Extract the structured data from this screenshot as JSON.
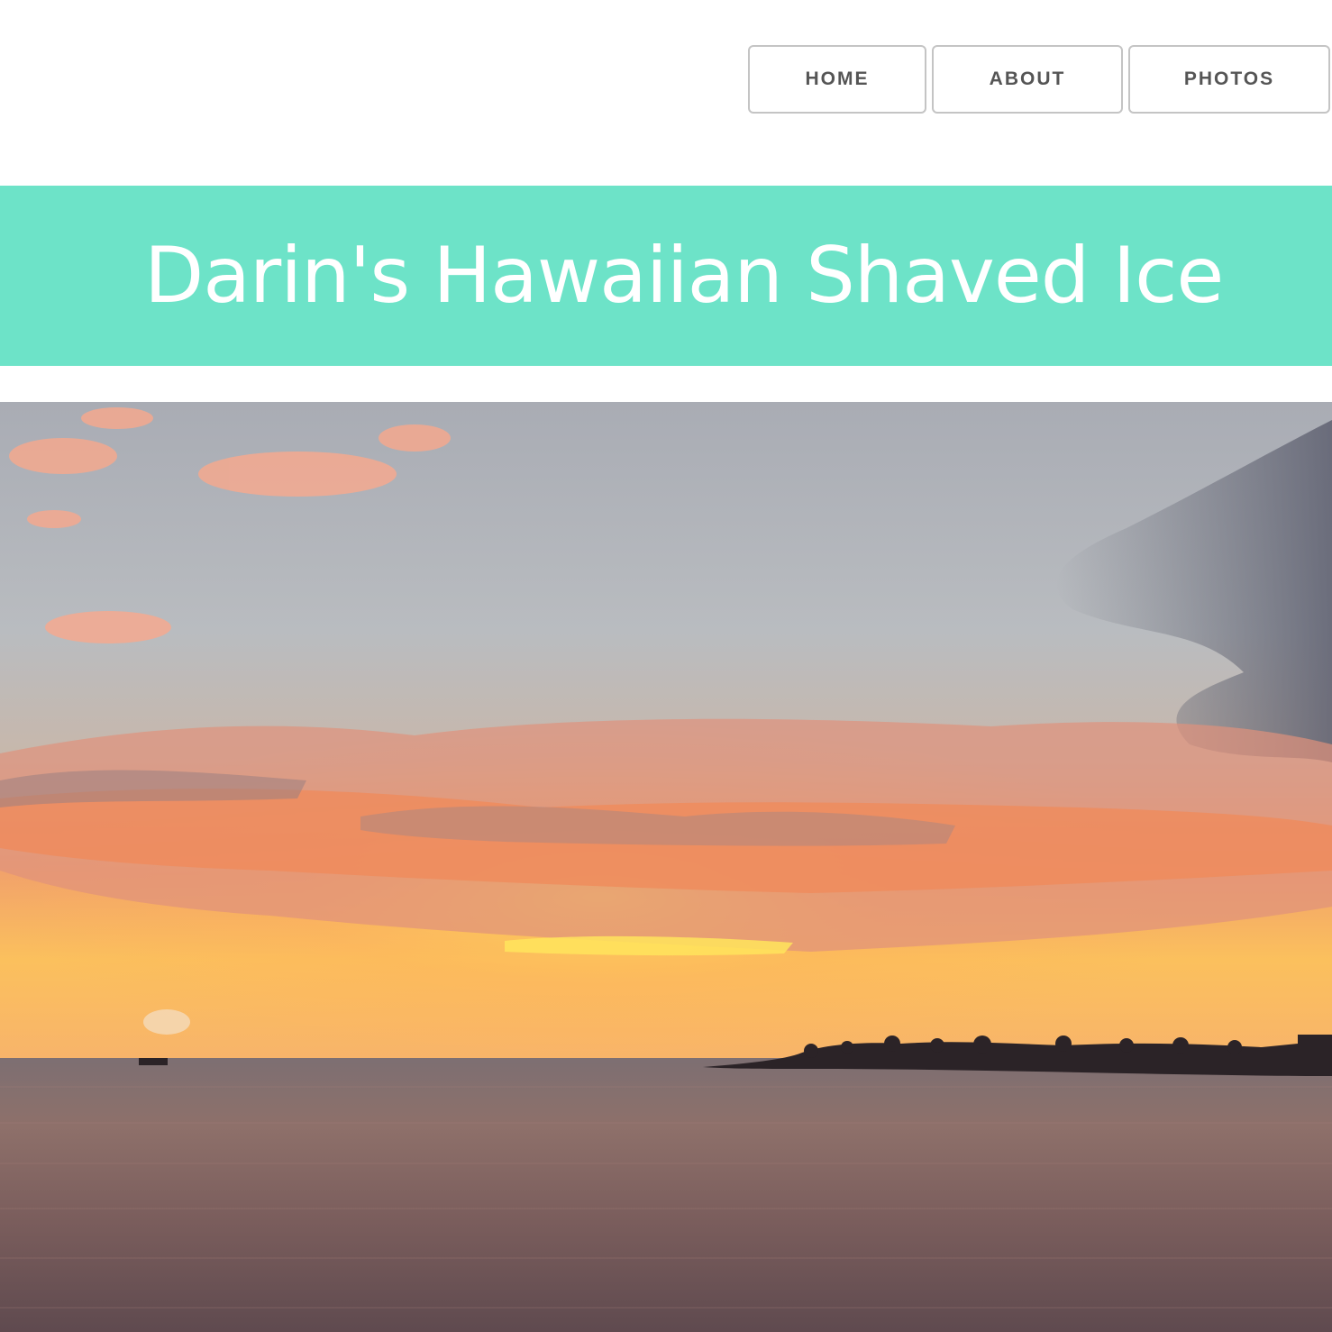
{
  "nav": {
    "items": [
      {
        "label": "HOME"
      },
      {
        "label": "ABOUT"
      },
      {
        "label": "PHOTOS"
      }
    ]
  },
  "banner": {
    "title": "Darin's Hawaiian Shaved Ice",
    "background_color": "#6de3c8",
    "text_color": "#ffffff"
  },
  "hero": {
    "image_subject": "sunset-over-ocean-photo"
  }
}
